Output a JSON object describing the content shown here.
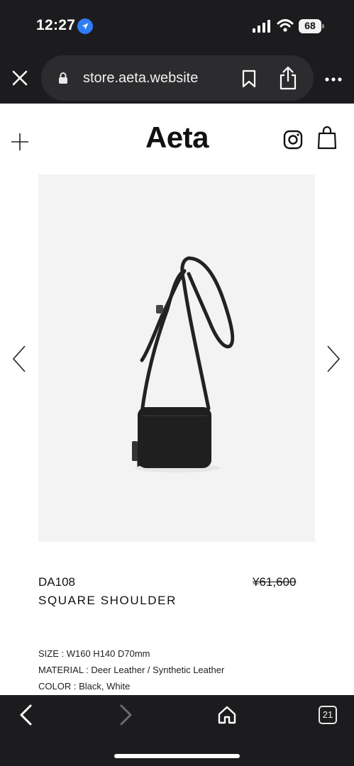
{
  "status_bar": {
    "time": "12:27",
    "battery": "68",
    "icons": [
      "location-arrow-icon",
      "cellular-signal-icon",
      "wifi-icon",
      "battery-icon"
    ]
  },
  "browser": {
    "url": "store.aeta.website",
    "tab_count": "21",
    "icons": [
      "close-icon",
      "lock-icon",
      "bookmark-icon",
      "share-icon",
      "more-icon",
      "back-icon",
      "forward-icon",
      "home-icon",
      "tabs-icon"
    ]
  },
  "site": {
    "logo": "Aeta",
    "icons": [
      "plus-icon",
      "instagram-icon",
      "shopping-bag-icon"
    ]
  },
  "product": {
    "code": "DA108",
    "price": "¥61,600",
    "name": "SQUARE SHOULDER",
    "size": "SIZE : W160 H140 D70mm",
    "material": "MATERIAL : Deer Leather / Synthetic Leather",
    "color": "COLOR : Black, White"
  },
  "colors": {
    "chrome": "#1c1c1e",
    "url_pill": "#2c2c2e",
    "image_bg": "#f3f3f3",
    "location_blue": "#2f7cf6"
  }
}
